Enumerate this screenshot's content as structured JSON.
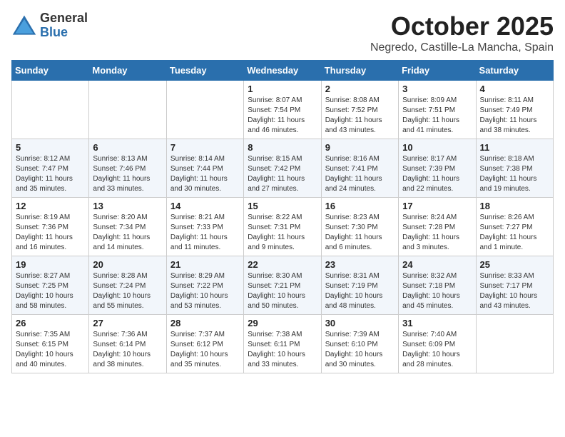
{
  "header": {
    "logo_general": "General",
    "logo_blue": "Blue",
    "month_title": "October 2025",
    "location": "Negredo, Castille-La Mancha, Spain"
  },
  "days_of_week": [
    "Sunday",
    "Monday",
    "Tuesday",
    "Wednesday",
    "Thursday",
    "Friday",
    "Saturday"
  ],
  "weeks": [
    [
      {
        "day": "",
        "info": ""
      },
      {
        "day": "",
        "info": ""
      },
      {
        "day": "",
        "info": ""
      },
      {
        "day": "1",
        "info": "Sunrise: 8:07 AM\nSunset: 7:54 PM\nDaylight: 11 hours and 46 minutes."
      },
      {
        "day": "2",
        "info": "Sunrise: 8:08 AM\nSunset: 7:52 PM\nDaylight: 11 hours and 43 minutes."
      },
      {
        "day": "3",
        "info": "Sunrise: 8:09 AM\nSunset: 7:51 PM\nDaylight: 11 hours and 41 minutes."
      },
      {
        "day": "4",
        "info": "Sunrise: 8:11 AM\nSunset: 7:49 PM\nDaylight: 11 hours and 38 minutes."
      }
    ],
    [
      {
        "day": "5",
        "info": "Sunrise: 8:12 AM\nSunset: 7:47 PM\nDaylight: 11 hours and 35 minutes."
      },
      {
        "day": "6",
        "info": "Sunrise: 8:13 AM\nSunset: 7:46 PM\nDaylight: 11 hours and 33 minutes."
      },
      {
        "day": "7",
        "info": "Sunrise: 8:14 AM\nSunset: 7:44 PM\nDaylight: 11 hours and 30 minutes."
      },
      {
        "day": "8",
        "info": "Sunrise: 8:15 AM\nSunset: 7:42 PM\nDaylight: 11 hours and 27 minutes."
      },
      {
        "day": "9",
        "info": "Sunrise: 8:16 AM\nSunset: 7:41 PM\nDaylight: 11 hours and 24 minutes."
      },
      {
        "day": "10",
        "info": "Sunrise: 8:17 AM\nSunset: 7:39 PM\nDaylight: 11 hours and 22 minutes."
      },
      {
        "day": "11",
        "info": "Sunrise: 8:18 AM\nSunset: 7:38 PM\nDaylight: 11 hours and 19 minutes."
      }
    ],
    [
      {
        "day": "12",
        "info": "Sunrise: 8:19 AM\nSunset: 7:36 PM\nDaylight: 11 hours and 16 minutes."
      },
      {
        "day": "13",
        "info": "Sunrise: 8:20 AM\nSunset: 7:34 PM\nDaylight: 11 hours and 14 minutes."
      },
      {
        "day": "14",
        "info": "Sunrise: 8:21 AM\nSunset: 7:33 PM\nDaylight: 11 hours and 11 minutes."
      },
      {
        "day": "15",
        "info": "Sunrise: 8:22 AM\nSunset: 7:31 PM\nDaylight: 11 hours and 9 minutes."
      },
      {
        "day": "16",
        "info": "Sunrise: 8:23 AM\nSunset: 7:30 PM\nDaylight: 11 hours and 6 minutes."
      },
      {
        "day": "17",
        "info": "Sunrise: 8:24 AM\nSunset: 7:28 PM\nDaylight: 11 hours and 3 minutes."
      },
      {
        "day": "18",
        "info": "Sunrise: 8:26 AM\nSunset: 7:27 PM\nDaylight: 11 hours and 1 minute."
      }
    ],
    [
      {
        "day": "19",
        "info": "Sunrise: 8:27 AM\nSunset: 7:25 PM\nDaylight: 10 hours and 58 minutes."
      },
      {
        "day": "20",
        "info": "Sunrise: 8:28 AM\nSunset: 7:24 PM\nDaylight: 10 hours and 55 minutes."
      },
      {
        "day": "21",
        "info": "Sunrise: 8:29 AM\nSunset: 7:22 PM\nDaylight: 10 hours and 53 minutes."
      },
      {
        "day": "22",
        "info": "Sunrise: 8:30 AM\nSunset: 7:21 PM\nDaylight: 10 hours and 50 minutes."
      },
      {
        "day": "23",
        "info": "Sunrise: 8:31 AM\nSunset: 7:19 PM\nDaylight: 10 hours and 48 minutes."
      },
      {
        "day": "24",
        "info": "Sunrise: 8:32 AM\nSunset: 7:18 PM\nDaylight: 10 hours and 45 minutes."
      },
      {
        "day": "25",
        "info": "Sunrise: 8:33 AM\nSunset: 7:17 PM\nDaylight: 10 hours and 43 minutes."
      }
    ],
    [
      {
        "day": "26",
        "info": "Sunrise: 7:35 AM\nSunset: 6:15 PM\nDaylight: 10 hours and 40 minutes."
      },
      {
        "day": "27",
        "info": "Sunrise: 7:36 AM\nSunset: 6:14 PM\nDaylight: 10 hours and 38 minutes."
      },
      {
        "day": "28",
        "info": "Sunrise: 7:37 AM\nSunset: 6:12 PM\nDaylight: 10 hours and 35 minutes."
      },
      {
        "day": "29",
        "info": "Sunrise: 7:38 AM\nSunset: 6:11 PM\nDaylight: 10 hours and 33 minutes."
      },
      {
        "day": "30",
        "info": "Sunrise: 7:39 AM\nSunset: 6:10 PM\nDaylight: 10 hours and 30 minutes."
      },
      {
        "day": "31",
        "info": "Sunrise: 7:40 AM\nSunset: 6:09 PM\nDaylight: 10 hours and 28 minutes."
      },
      {
        "day": "",
        "info": ""
      }
    ]
  ]
}
